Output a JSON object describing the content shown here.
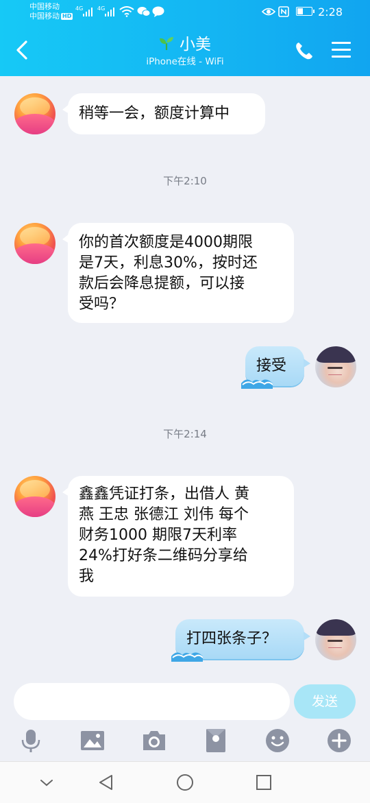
{
  "status_bar": {
    "carrier_1": "中国移动",
    "carrier_2": "中国移动",
    "hd_badge": "HD",
    "network_1": "4G",
    "network_2": "4G",
    "time": "2:28",
    "battery_level": 0.4,
    "icons": [
      "signal-icon",
      "wifi-icon",
      "wechat-icon",
      "message-icon",
      "eye-icon",
      "nfc-icon",
      "battery-icon"
    ]
  },
  "header": {
    "title": "小美",
    "subtitle": "iPhone在线 - WiFi",
    "icons": [
      "back-icon",
      "sprout-icon",
      "phone-icon",
      "menu-icon"
    ]
  },
  "messages": [
    {
      "side": "left",
      "text": "稍等一会，额度计算中"
    },
    {
      "type": "time",
      "text": "下午2:10"
    },
    {
      "side": "left",
      "lines": [
        "你的首次额度是4000期限",
        "是7天，利息30%，按时还",
        "款后会降息提额，可以接",
        "受吗？"
      ]
    },
    {
      "side": "right",
      "text": "接受"
    },
    {
      "type": "time",
      "text": "下午2:14"
    },
    {
      "side": "left",
      "lines": [
        "鑫鑫凭证打条，出借人 黄",
        "燕 王忠 张德江 刘伟 每个",
        "财务1000  期限7天利率",
        "24%打好条二维码分享给",
        "我"
      ]
    },
    {
      "side": "right",
      "text": "打四张条子？"
    }
  ],
  "input": {
    "placeholder": "",
    "send_label": "发送"
  },
  "toolbar": [
    "mic-icon",
    "image-icon",
    "camera-icon",
    "red-packet-icon",
    "emoji-icon",
    "plus-icon"
  ],
  "nav_bar": [
    "collapse-icon",
    "back-nav-icon",
    "home-icon",
    "recents-icon"
  ],
  "colors": {
    "header_start": "#16c9f6",
    "header_end": "#11a5f0",
    "background": "#eef0f6",
    "right_bubble": "#b3def8",
    "send_button": "#a8e6f7"
  }
}
